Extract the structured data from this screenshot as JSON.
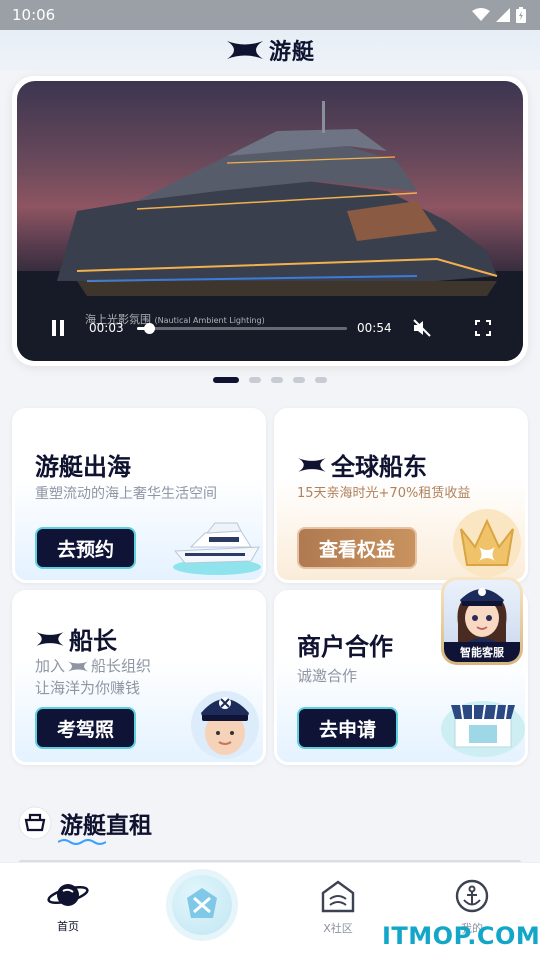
{
  "status": {
    "time": "10:06"
  },
  "header": {
    "brand": "游艇"
  },
  "hero": {
    "caption": "海上光影氛围",
    "caption_en": "(Nautical Ambient Lighting)",
    "current_time": "00:03",
    "total_time": "00:54",
    "progress": 0.055,
    "slides": 5,
    "active_slide": 0
  },
  "cards": {
    "yacht": {
      "title": "游艇出海",
      "subtitle": "重塑流动的海上奢华生活空间",
      "button": "去预约"
    },
    "owner": {
      "title": "全球船东",
      "subtitle": "15天亲海时光+70%租赁收益",
      "button": "查看权益"
    },
    "captain": {
      "title": "船长",
      "subtitle_line1": "加入",
      "subtitle_line1_tail": "船长组织",
      "subtitle_line2": "让海洋为你赚钱",
      "button": "考驾照"
    },
    "merchant": {
      "title": "商户合作",
      "subtitle": "诚邀合作",
      "button": "去申请"
    }
  },
  "chat": {
    "label": "智能客服"
  },
  "section": {
    "title": "游艇直租"
  },
  "tabs": [
    {
      "label": "首页"
    },
    {
      "label": ""
    },
    {
      "label": "X社区"
    },
    {
      "label": "我的"
    }
  ],
  "watermark": "ITMOP.COM",
  "colors": {
    "navy": "#0f1330",
    "accent": "#5fd0e0",
    "gold": "#c9935f"
  }
}
